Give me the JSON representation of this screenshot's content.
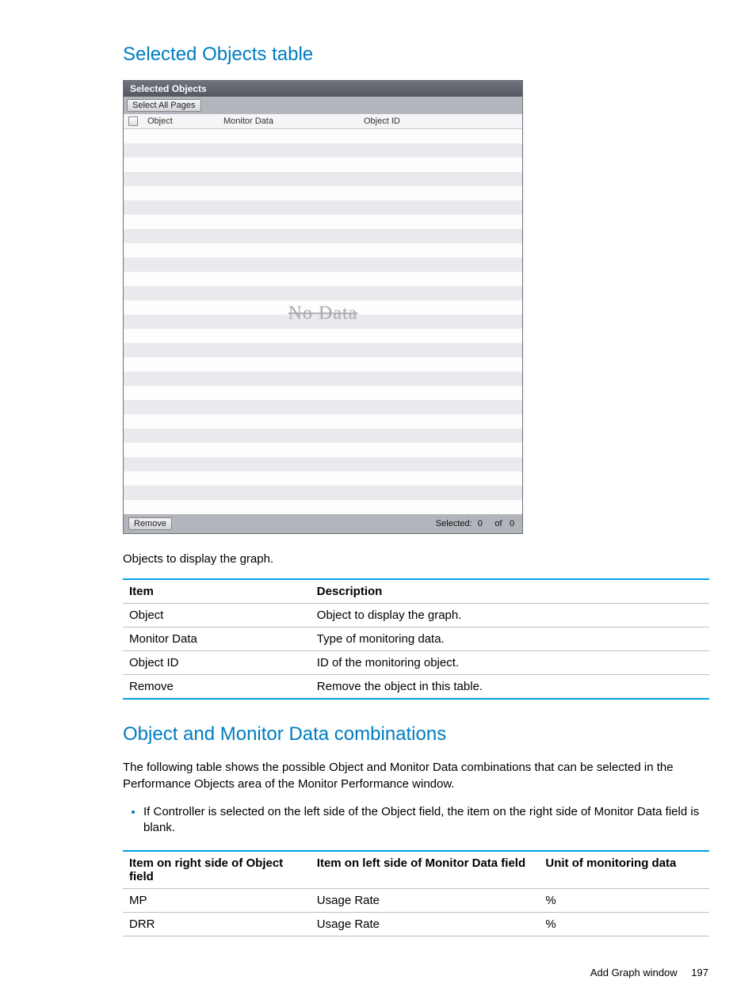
{
  "section1_title": "Selected Objects table",
  "panel": {
    "header": "Selected Objects",
    "select_all_label": "Select All Pages",
    "cols": {
      "object": "Object",
      "monitor": "Monitor Data",
      "objid": "Object ID"
    },
    "no_data": "No Data",
    "remove_label": "Remove",
    "selected_label": "Selected:",
    "selected_count": "0",
    "of_label": "of",
    "total_count": "0"
  },
  "caption1": "Objects to display the graph.",
  "desc_table": {
    "h_item": "Item",
    "h_desc": "Description",
    "rows": [
      {
        "item": "Object",
        "desc": "Object to display the graph."
      },
      {
        "item": "Monitor Data",
        "desc": "Type of monitoring data."
      },
      {
        "item": "Object ID",
        "desc": "ID of the monitoring object."
      },
      {
        "item": "Remove",
        "desc": "Remove the object in this table."
      }
    ]
  },
  "section2_title": "Object and Monitor Data combinations",
  "section2_intro": "The following table shows the possible Object and Monitor Data combinations that can be selected in the Performance Objects area of the Monitor Performance window.",
  "bullet1": "If Controller is selected on the left side of the Object field, the item on the right side of Monitor Data field is blank.",
  "combo_table": {
    "h1": "Item on right side of Object field",
    "h2": "Item on left side of Monitor Data field",
    "h3": "Unit of monitoring data",
    "rows": [
      {
        "c1": "MP",
        "c2": "Usage Rate",
        "c3": "%"
      },
      {
        "c1": "DRR",
        "c2": "Usage Rate",
        "c3": "%"
      }
    ]
  },
  "footer": {
    "title": "Add Graph window",
    "page": "197"
  }
}
